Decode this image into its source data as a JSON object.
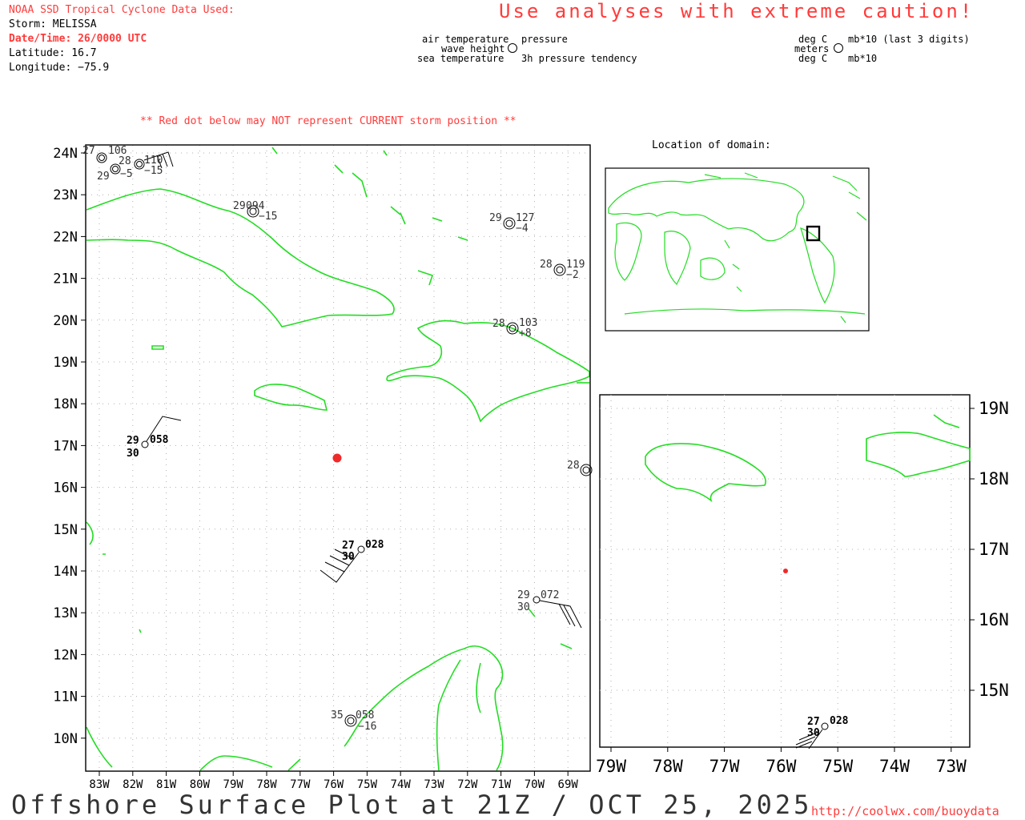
{
  "header": {
    "source": "NOAA SSD Tropical Cyclone Data Used:",
    "storm": "Storm: MELISSA",
    "datetime": "Date/Time: 26/0000 UTC",
    "latitude": "Latitude: 16.7",
    "longitude": "Longitude: −75.9"
  },
  "caution": "Use analyses with extreme caution!",
  "legend_left": {
    "air_temp": "air temperature",
    "pressure": "pressure",
    "wave_height": "wave height",
    "sea_temp": "sea temperature",
    "tendency": "3h pressure tendency"
  },
  "legend_right": {
    "deg_c_top": "deg C",
    "mb_last3": "mb*10 (last 3 digits)",
    "meters": "meters",
    "deg_c_bottom": "deg C",
    "mb10": "mb*10"
  },
  "red_dot_note": "** Red dot below may NOT represent CURRENT storm position **",
  "location_title": "Location of domain:",
  "footer": {
    "title": "Offshore Surface Plot at 21Z / OCT 25, 2025",
    "url": "http://coolwx.com/buoydata"
  },
  "colors": {
    "accent_red": "#ff3b3b",
    "coast": "#22dd22",
    "grid": "#b0b0b0"
  },
  "main_map": {
    "lat_labels": [
      "24N",
      "23N",
      "22N",
      "21N",
      "20N",
      "19N",
      "18N",
      "17N",
      "16N",
      "15N",
      "14N",
      "13N",
      "12N",
      "11N",
      "10N"
    ],
    "lon_labels": [
      "83W",
      "82W",
      "81W",
      "80W",
      "79W",
      "78W",
      "77W",
      "76W",
      "75W",
      "74W",
      "73W",
      "72W",
      "71W",
      "70W",
      "69W"
    ]
  },
  "inset_map": {
    "lat_labels": [
      "19N",
      "18N",
      "17N",
      "16N",
      "15N"
    ],
    "lon_labels": [
      "79W",
      "78W",
      "77W",
      "76W",
      "75W",
      "74W",
      "73W"
    ]
  },
  "storm": {
    "lat": 16.7,
    "lon": -75.9
  },
  "stations": [
    {
      "id": "st-nw-1",
      "air": "27",
      "pres": "106",
      "wave": "",
      "sst": "",
      "tend": ""
    },
    {
      "id": "st-nw-2",
      "air": "28",
      "pres": "110",
      "wave": "",
      "sst": "",
      "tend": "−15"
    },
    {
      "id": "st-nw-3",
      "air": "29",
      "pres": "",
      "wave": "",
      "sst": "",
      "tend": "−5"
    },
    {
      "id": "st-cuba",
      "air": "29",
      "pres": "094",
      "wave": "",
      "sst": "",
      "tend": "−15"
    },
    {
      "id": "st-ne-1",
      "air": "29",
      "pres": "127",
      "wave": "",
      "sst": "",
      "tend": "−4"
    },
    {
      "id": "st-ne-2",
      "air": "28",
      "pres": "119",
      "wave": "",
      "sst": "",
      "tend": "−2"
    },
    {
      "id": "st-hisp",
      "air": "28",
      "pres": "103",
      "wave": "",
      "sst": "",
      "tend": "+8"
    },
    {
      "id": "st-east",
      "air": "28",
      "pres": "",
      "wave": "",
      "sst": "",
      "tend": ""
    },
    {
      "id": "st-west",
      "air": "29",
      "pres": "058",
      "wave": "",
      "sst": "30",
      "tend": ""
    },
    {
      "id": "st-south",
      "air": "27",
      "pres": "028",
      "wave": "",
      "sst": "30",
      "tend": ""
    },
    {
      "id": "st-se",
      "air": "29",
      "pres": "072",
      "wave": "",
      "sst": "30",
      "tend": ""
    },
    {
      "id": "st-venez",
      "air": "35",
      "pres": "058",
      "wave": "",
      "sst": "",
      "tend": "−16"
    },
    {
      "id": "st-inset",
      "air": "27",
      "pres": "028",
      "wave": "",
      "sst": "30",
      "tend": ""
    }
  ]
}
